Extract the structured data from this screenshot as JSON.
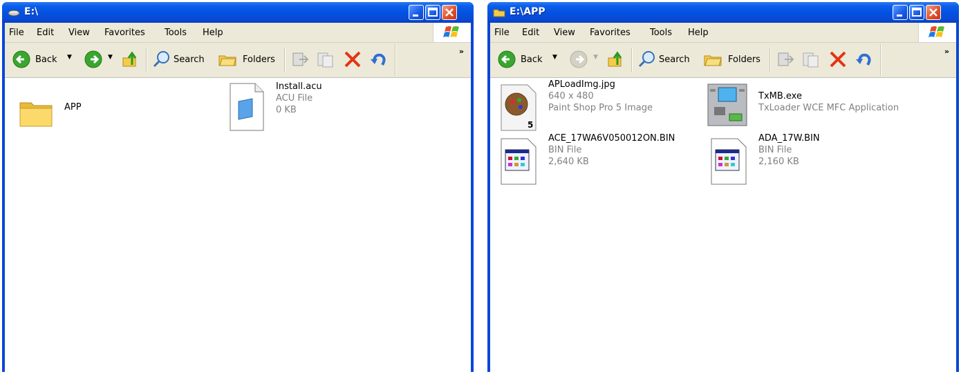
{
  "windows": [
    {
      "title": "E:\\",
      "menu": [
        "File",
        "Edit",
        "View",
        "Favorites",
        "Tools",
        "Help"
      ],
      "toolbar": {
        "back": "Back",
        "search": "Search",
        "folders": "Folders",
        "more": "»"
      },
      "items": [
        {
          "name": "APP",
          "icon": "folder-icon"
        },
        {
          "name": "Install.acu",
          "type": "ACU File",
          "size": "0 KB",
          "icon": "acu-file-icon"
        }
      ]
    },
    {
      "title": "E:\\APP",
      "menu": [
        "File",
        "Edit",
        "View",
        "Favorites",
        "Tools",
        "Help"
      ],
      "toolbar": {
        "back": "Back",
        "search": "Search",
        "folders": "Folders",
        "more": "»"
      },
      "items": [
        {
          "name": "APLoadImg.jpg",
          "dimensions": "640 x 480",
          "type": "Paint Shop Pro 5 Image",
          "icon": "paintshop-image-icon"
        },
        {
          "name": "TxMB.exe",
          "type": "TxLoader WCE MFC Application",
          "icon": "atm-application-icon"
        },
        {
          "name": "ACE_17WA6V050012ON.BIN",
          "type": "BIN File",
          "size": "2,640 KB",
          "icon": "bin-file-icon"
        },
        {
          "name": "ADA_17W.BIN",
          "type": "BIN File",
          "size": "2,160 KB",
          "icon": "bin-file-icon"
        }
      ]
    }
  ],
  "colors": {
    "titlebar": "#0a5ee8",
    "chrome": "#ece9d8",
    "close": "#e2532c",
    "secondary_text": "#808080"
  }
}
